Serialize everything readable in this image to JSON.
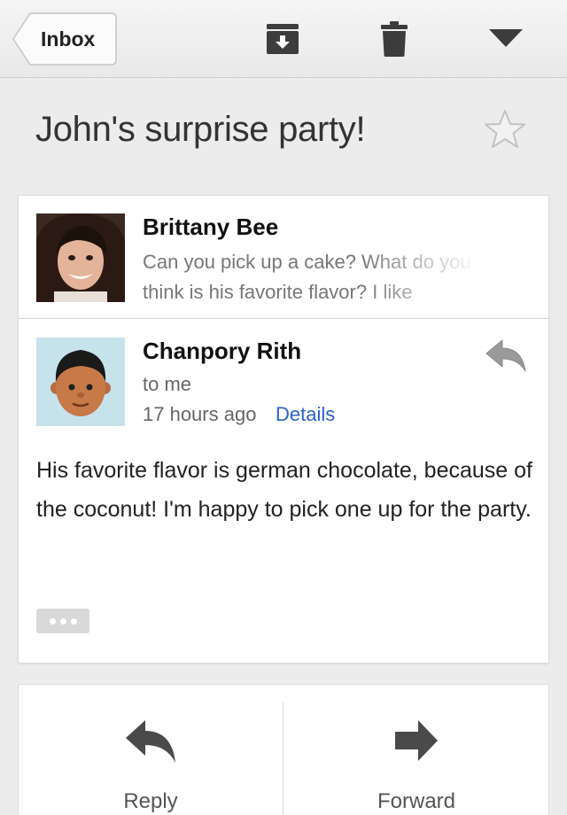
{
  "toolbar": {
    "back_label": "Inbox",
    "icons": [
      "archive-icon",
      "trash-icon",
      "dropdown-icon"
    ]
  },
  "subject": "John's surprise party!",
  "messages": [
    {
      "sender": "Brittany Bee",
      "snippet": "Can you pick up a cake? What do you think is his favorite flavor? I like"
    },
    {
      "sender": "Chanpory Rith",
      "to": "to me",
      "time": "17 hours ago",
      "details_link": "Details",
      "body": "His favorite flavor is german chocolate, because of the coconut! I'm happy to pick one up for the party."
    }
  ],
  "actions": {
    "reply_label": "Reply",
    "forward_label": "Forward"
  },
  "colors": {
    "link": "#2a62c9",
    "background": "#ececec"
  }
}
